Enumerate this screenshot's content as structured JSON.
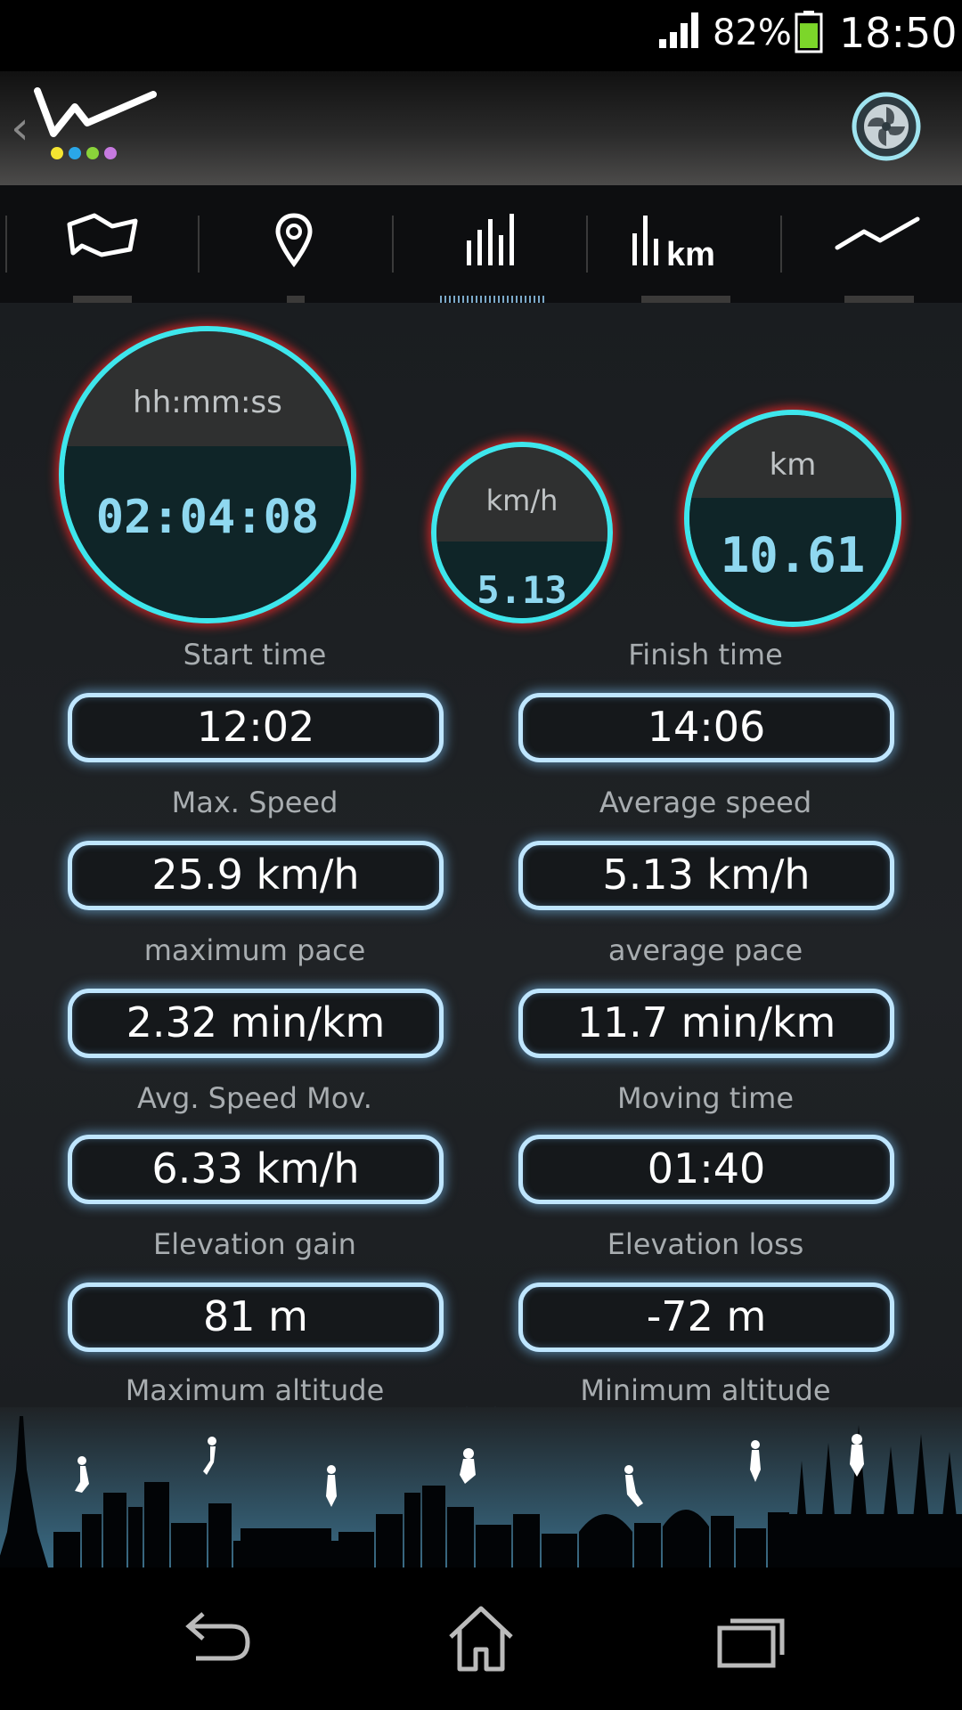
{
  "status_bar": {
    "battery": "82%",
    "time": "18:50",
    "battery_level": 0.82
  },
  "colors": {
    "accent": "#3ee6ec",
    "glow": "#ff2828",
    "value": "#8fd8f0"
  },
  "tabs": [
    {
      "icon": "map-icon"
    },
    {
      "icon": "location-pin-icon"
    },
    {
      "icon": "bar-chart-icon",
      "active": true
    },
    {
      "icon": "bar-chart-km-icon",
      "label": "km"
    },
    {
      "icon": "line-chart-icon"
    }
  ],
  "gauges": {
    "duration": {
      "unit": "hh:mm:ss",
      "value": "02:04:08"
    },
    "speed": {
      "unit": "km/h",
      "value": "5.13"
    },
    "distance": {
      "unit": "km",
      "value": "10.61"
    }
  },
  "stats": [
    {
      "label": "Start time",
      "value": "12:02"
    },
    {
      "label": "Finish time",
      "value": "14:06"
    },
    {
      "label": "Max. Speed",
      "value": "25.9 km/h"
    },
    {
      "label": "Average speed",
      "value": "5.13 km/h"
    },
    {
      "label": "maximum pace",
      "value": "2.32 min/km"
    },
    {
      "label": "average pace",
      "value": "11.7 min/km"
    },
    {
      "label": "Avg. Speed Mov.",
      "value": "6.33 km/h"
    },
    {
      "label": "Moving time",
      "value": "01:40"
    },
    {
      "label": "Elevation gain",
      "value": "81 m"
    },
    {
      "label": "Elevation loss",
      "value": "-72 m"
    },
    {
      "label": "Maximum altitude"
    },
    {
      "label": "Minimum altitude"
    }
  ]
}
